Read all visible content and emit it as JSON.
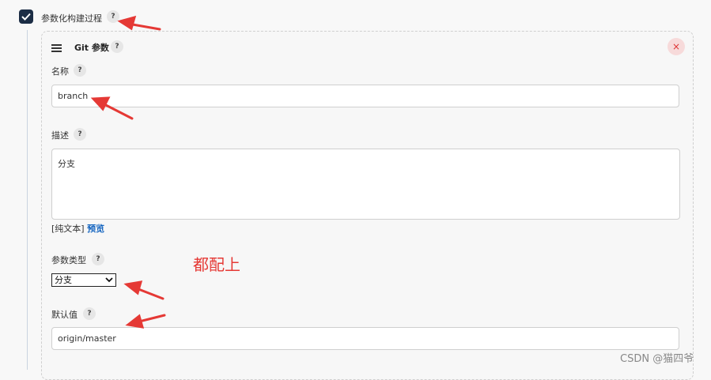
{
  "section": {
    "title": "参数化构建过程",
    "help": "?"
  },
  "param": {
    "type_title": "Git 参数",
    "help": "?",
    "close": "×",
    "name_label": "名称",
    "name_value": "branch",
    "desc_label": "描述",
    "desc_value": "分支",
    "desc_format": "[纯文本]",
    "desc_preview": "预览",
    "ptype_label": "参数类型",
    "ptype_selected": "分支",
    "default_label": "默认值",
    "default_value": "origin/master"
  },
  "annotation": "都配上",
  "watermark": "CSDN @猫四爷",
  "icons": [
    "checkmark-icon",
    "question-icon",
    "hamburger-icon",
    "close-icon",
    "chevron-down-icon",
    "red-arrow-icon"
  ],
  "colors": {
    "accent": "#1c2d45",
    "annotation_red": "#e53935",
    "link": "#1565c0"
  }
}
